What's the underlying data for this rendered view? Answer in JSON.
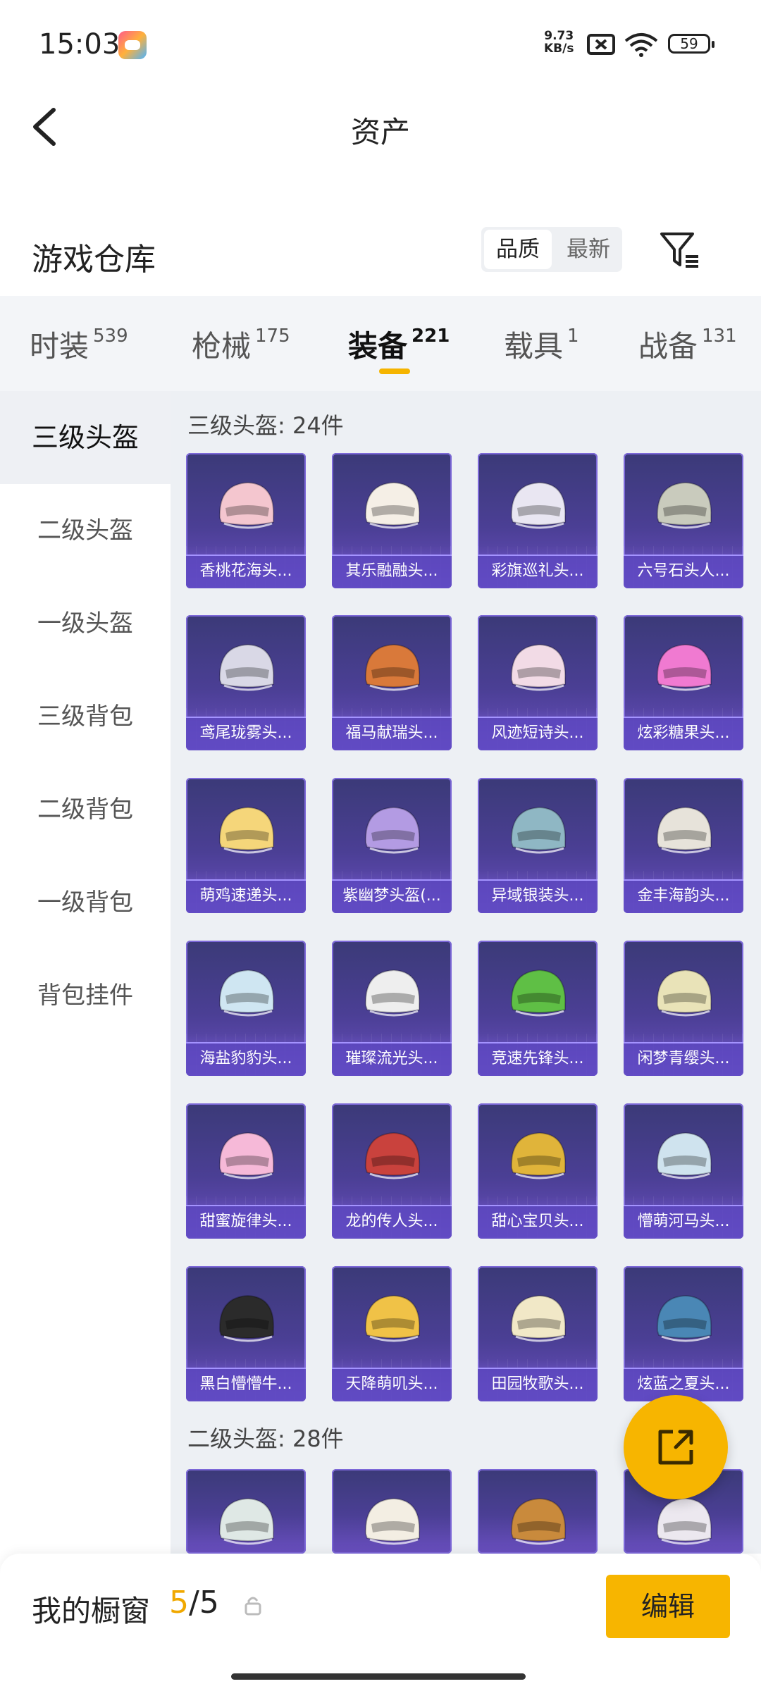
{
  "status_bar": {
    "time": "15:03",
    "speed_value": "9.73",
    "speed_unit": "KB/s",
    "battery": "59"
  },
  "nav": {
    "title": "资产"
  },
  "warehouse": {
    "title": "游戏仓库",
    "sort_quality": "品质",
    "sort_newest": "最新"
  },
  "tabs": [
    {
      "label": "时装",
      "count": "539"
    },
    {
      "label": "枪械",
      "count": "175"
    },
    {
      "label": "装备",
      "count": "221"
    },
    {
      "label": "载具",
      "count": "1"
    },
    {
      "label": "战备",
      "count": "131"
    }
  ],
  "sidebar": [
    "三级头盔",
    "二级头盔",
    "一级头盔",
    "三级背包",
    "二级背包",
    "一级背包",
    "背包挂件"
  ],
  "sections": [
    {
      "title": "三级头盔: 24件"
    },
    {
      "title": "二级头盔: 28件"
    }
  ],
  "items": [
    "香桃花海头...",
    "其乐融融头...",
    "彩旗巡礼头...",
    "六号石头人...",
    "鸢尾珑雾头...",
    "福马献瑞头...",
    "风迹短诗头...",
    "炫彩糖果头...",
    "萌鸡速递头...",
    "紫幽梦头盔(...",
    "异域银装头...",
    "金丰海韵头...",
    "海盐豹豹头...",
    "璀璨流光头...",
    "竞速先锋头...",
    "闲梦青缨头...",
    "甜蜜旋律头...",
    "龙的传人头...",
    "甜心宝贝头...",
    "懵萌河马头...",
    "黑白懵懵牛...",
    "天降萌叽头...",
    "田园牧歌头...",
    "炫蓝之夏头..."
  ],
  "helmet_colors": [
    "#f4c6cf",
    "#f5efe6",
    "#e9e6f2",
    "#c9cbbd",
    "#d9d8e6",
    "#d9793a",
    "#f2dbe6",
    "#f07ad1",
    "#f5d67a",
    "#b39be3",
    "#8fb7c4",
    "#e7e3da",
    "#cfe6f2",
    "#eeeeee",
    "#5fbf45",
    "#e9e3b8",
    "#f6b9d8",
    "#c9423d",
    "#e0b43a",
    "#cfe3ee",
    "#2b2b2b",
    "#f0c247",
    "#f1e8c7",
    "#4a87b5"
  ],
  "partial_colors": [
    "#dfe8e5",
    "#f3eee3",
    "#c98a3c",
    "#ece8ef"
  ],
  "showcase": {
    "title": "我的橱窗",
    "current": "5",
    "total": "/5",
    "edit_label": "编辑"
  }
}
